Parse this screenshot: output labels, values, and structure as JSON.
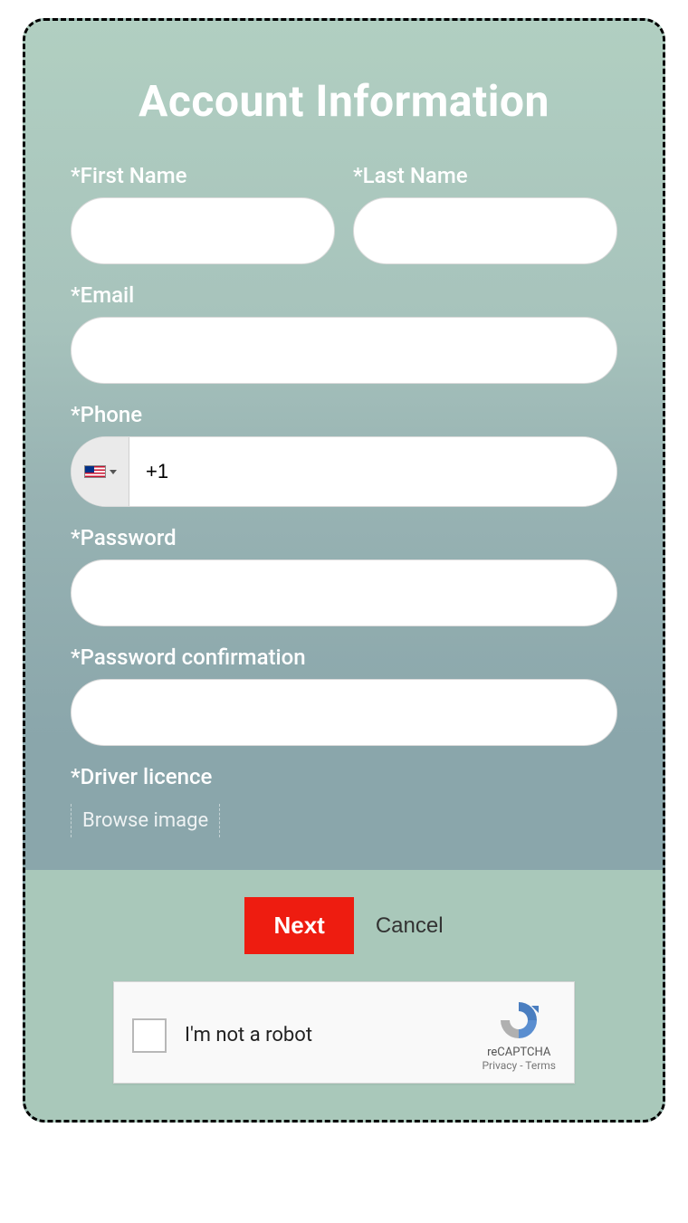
{
  "form": {
    "title": "Account Information",
    "first_name_label": "*First Name",
    "last_name_label": "*Last Name",
    "email_label": "*Email",
    "phone_label": "*Phone",
    "phone_prefix": "+1",
    "password_label": "*Password",
    "password_confirm_label": "*Password confirmation",
    "driver_licence_label": "*Driver licence",
    "browse_label": "Browse image",
    "first_name_value": "",
    "last_name_value": "",
    "email_value": "",
    "phone_value": "",
    "password_value": "",
    "password_confirm_value": ""
  },
  "buttons": {
    "next": "Next",
    "cancel": "Cancel"
  },
  "recaptcha": {
    "label": "I'm not a robot",
    "brand": "reCAPTCHA",
    "privacy": "Privacy",
    "terms": "Terms"
  }
}
